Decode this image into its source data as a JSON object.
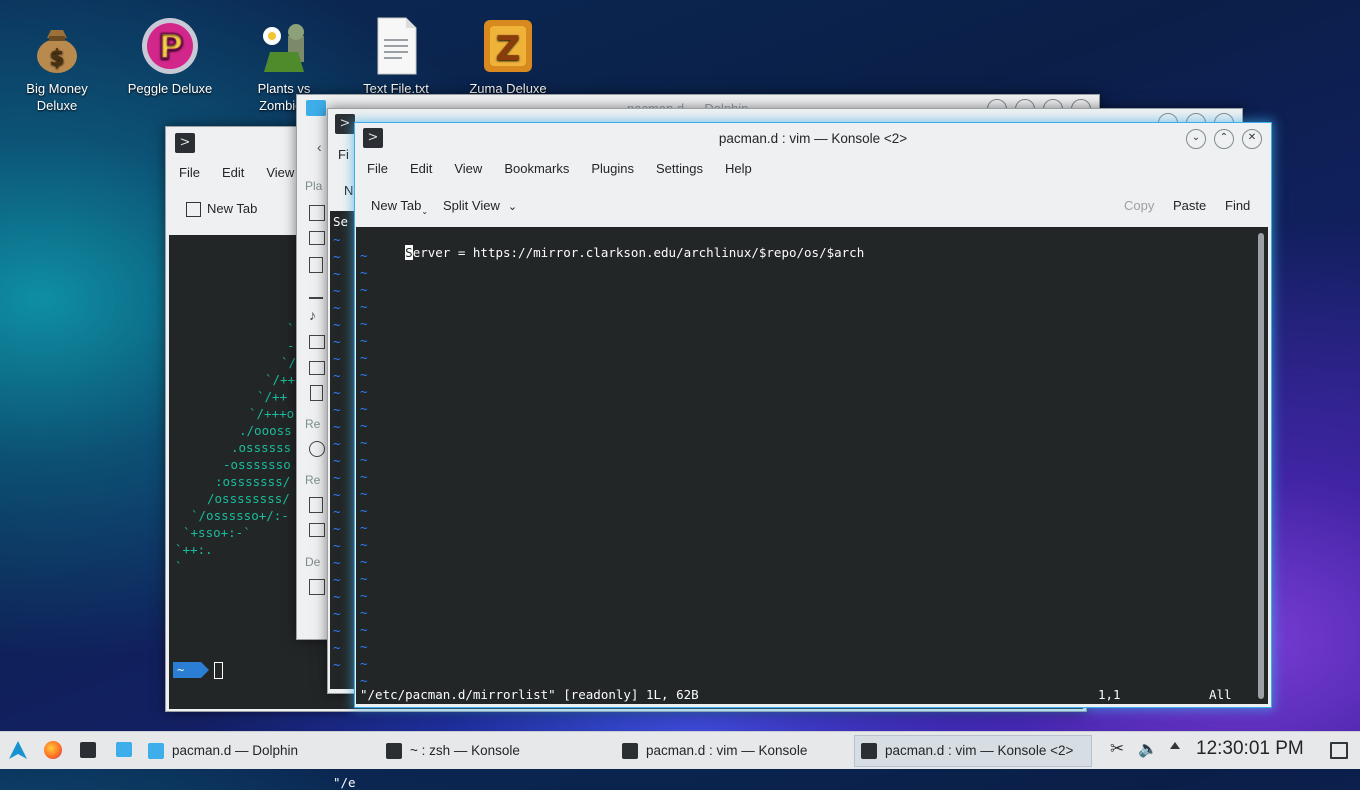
{
  "desktop": {
    "icons": [
      {
        "label": "Big Money Deluxe",
        "icon": "money-bag-icon"
      },
      {
        "label": "Peggle Deluxe",
        "icon": "peggle-icon"
      },
      {
        "label": "Plants vs Zombies",
        "icon": "plants-icon"
      },
      {
        "label": "Text File.txt",
        "icon": "text-file-icon"
      },
      {
        "label": "Zuma Deluxe",
        "icon": "zuma-icon"
      }
    ]
  },
  "dolphin": {
    "title": "pacman.d — Dolphin",
    "sidebar_labels": [
      "Pla",
      "Re",
      "Re",
      "De"
    ],
    "nav_label": "N"
  },
  "konsole_zsh": {
    "menu": [
      "File",
      "Edit",
      "View"
    ],
    "toolbar_new_tab": "New Tab",
    "ascii": [
      "`",
      "-",
      "`/:",
      "`/++",
      "`/++",
      "`/+++o",
      "./oooss",
      ".ossssss",
      "-osssssso",
      ":osssssss/",
      "/ossssssss/",
      "`/ossssso+/:-",
      "`+sso+:-`",
      "`++:.",
      "`"
    ],
    "prompt": "~"
  },
  "konsole_middle": {
    "menu_partial": "Fi",
    "nav_partial": "N",
    "first_line": "Se",
    "status_partial": "\"/e"
  },
  "konsole_front": {
    "title": "pacman.d : vim — Konsole <2>",
    "menu": [
      "File",
      "Edit",
      "View",
      "Bookmarks",
      "Plugins",
      "Settings",
      "Help"
    ],
    "toolbar": {
      "new_tab": "New Tab",
      "split_view": "Split View",
      "copy": "Copy",
      "paste": "Paste",
      "find": "Find"
    },
    "vim": {
      "cursor_char": "S",
      "line1_rest": "erver = https://mirror.clarkson.edu/archlinux/$repo/os/$arch",
      "tilde": "~",
      "status_file": "\"/etc/pacman.d/mirrorlist\" [readonly] 1L, 62B",
      "status_pos": "1,1",
      "status_all": "All"
    }
  },
  "taskbar": {
    "tasks": [
      {
        "label": "pacman.d — Dolphin"
      },
      {
        "label": "~ : zsh — Konsole"
      },
      {
        "label": "pacman.d : vim — Konsole"
      },
      {
        "label": "pacman.d : vim — Konsole <2>"
      }
    ],
    "clock": "12:30:01 PM"
  },
  "colors": {
    "terminal_bg": "#232627",
    "terminal_fg": "#fcfcfc",
    "ascii_green": "#1abc9c",
    "tilde_blue": "#2a7fff",
    "accent": "#3daee9"
  }
}
